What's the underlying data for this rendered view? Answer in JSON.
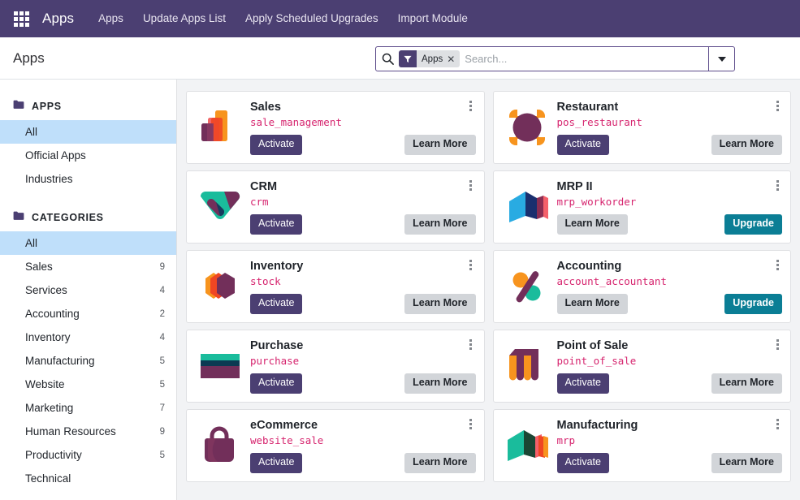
{
  "navbar": {
    "apps_grid_icon": "grid-icon",
    "brand": "Apps",
    "items": [
      {
        "label": "Apps"
      },
      {
        "label": "Update Apps List"
      },
      {
        "label": "Apply Scheduled Upgrades"
      },
      {
        "label": "Import Module"
      }
    ]
  },
  "control_panel": {
    "title": "Apps",
    "search": {
      "icon": "search-icon",
      "facet": {
        "icon": "filter-funnel-icon",
        "label": "Apps",
        "close": "✕"
      },
      "placeholder": "Search...",
      "value": "",
      "dropdown_icon": "chevron-down-icon"
    }
  },
  "sidebar": {
    "sections": [
      {
        "icon": "folder-icon",
        "title": "APPS",
        "items": [
          {
            "label": "All",
            "count": "",
            "active": true
          },
          {
            "label": "Official Apps",
            "count": "",
            "active": false
          },
          {
            "label": "Industries",
            "count": "",
            "active": false
          }
        ]
      },
      {
        "icon": "folder-icon",
        "title": "CATEGORIES",
        "items": [
          {
            "label": "All",
            "count": "",
            "active": true
          },
          {
            "label": "Sales",
            "count": "9",
            "active": false
          },
          {
            "label": "Services",
            "count": "4",
            "active": false
          },
          {
            "label": "Accounting",
            "count": "2",
            "active": false
          },
          {
            "label": "Inventory",
            "count": "4",
            "active": false
          },
          {
            "label": "Manufacturing",
            "count": "5",
            "active": false
          },
          {
            "label": "Website",
            "count": "5",
            "active": false
          },
          {
            "label": "Marketing",
            "count": "7",
            "active": false
          },
          {
            "label": "Human Resources",
            "count": "9",
            "active": false
          },
          {
            "label": "Productivity",
            "count": "5",
            "active": false
          },
          {
            "label": "Technical",
            "count": "",
            "active": false
          }
        ]
      }
    ]
  },
  "apps": [
    {
      "name": "Sales",
      "technical_name": "sale_management",
      "icon": "sales-bar-chart-icon",
      "primary_button": "Activate",
      "secondary_button": "Learn More",
      "upgrade_button": ""
    },
    {
      "name": "Restaurant",
      "technical_name": "pos_restaurant",
      "icon": "restaurant-circle-icon",
      "primary_button": "Activate",
      "secondary_button": "Learn More",
      "upgrade_button": ""
    },
    {
      "name": "CRM",
      "technical_name": "crm",
      "icon": "crm-arrow-icon",
      "primary_button": "Activate",
      "secondary_button": "Learn More",
      "upgrade_button": ""
    },
    {
      "name": "MRP II",
      "technical_name": "mrp_workorder",
      "icon": "mrp-book-icon",
      "primary_button": "",
      "secondary_button": "Learn More",
      "upgrade_button": "Upgrade"
    },
    {
      "name": "Inventory",
      "technical_name": "stock",
      "icon": "inventory-cube-icon",
      "primary_button": "Activate",
      "secondary_button": "Learn More",
      "upgrade_button": ""
    },
    {
      "name": "Accounting",
      "technical_name": "account_accountant",
      "icon": "accounting-percent-icon",
      "primary_button": "",
      "secondary_button": "Learn More",
      "upgrade_button": "Upgrade"
    },
    {
      "name": "Purchase",
      "technical_name": "purchase",
      "icon": "purchase-card-icon",
      "primary_button": "Activate",
      "secondary_button": "Learn More",
      "upgrade_button": ""
    },
    {
      "name": "Point of Sale",
      "technical_name": "point_of_sale",
      "icon": "pos-awning-icon",
      "primary_button": "Activate",
      "secondary_button": "Learn More",
      "upgrade_button": ""
    },
    {
      "name": "eCommerce",
      "technical_name": "website_sale",
      "icon": "ecommerce-bag-icon",
      "primary_button": "Activate",
      "secondary_button": "Learn More",
      "upgrade_button": ""
    },
    {
      "name": "Manufacturing",
      "technical_name": "mrp",
      "icon": "manufacturing-book-icon",
      "primary_button": "Activate",
      "secondary_button": "Learn More",
      "upgrade_button": ""
    }
  ],
  "colors": {
    "brand_purple": "#4b3f72",
    "accent_pink": "#d6246e",
    "upgrade_teal": "#0b7e95",
    "selected_blue": "#bfdffa",
    "page_bg": "#f2f3f5"
  }
}
